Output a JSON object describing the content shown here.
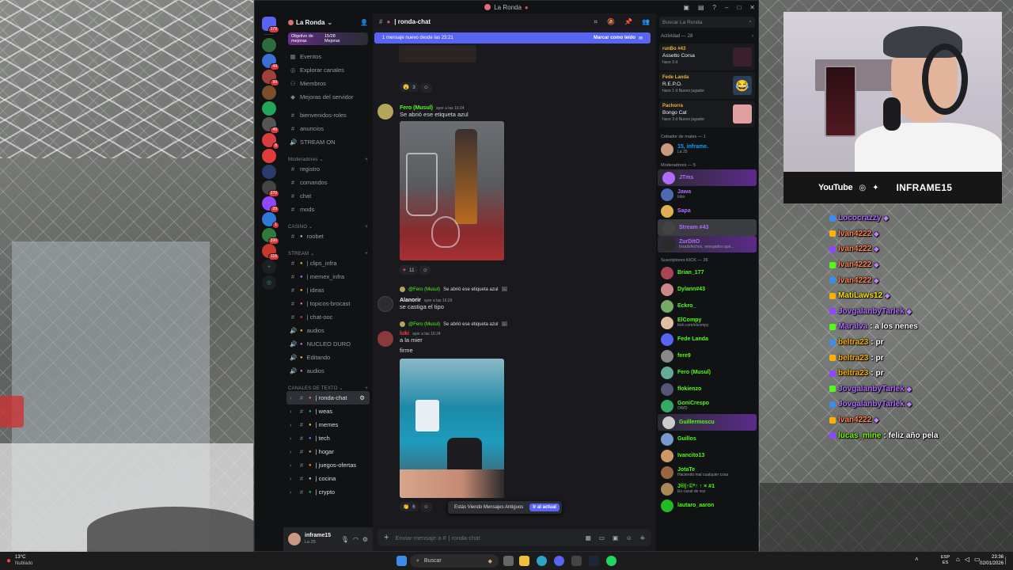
{
  "window": {
    "title": "La Ronda"
  },
  "rail": {
    "servers": [
      {
        "name": "home",
        "badge": "179",
        "color": "#5865f2"
      },
      {
        "name": "la-ronda",
        "badge": "",
        "color": "#2d6b3a"
      },
      {
        "name": "server-3",
        "badge": "44",
        "color": "#3b6fd6"
      },
      {
        "name": "server-4",
        "badge": "99",
        "color": "#a0403a"
      },
      {
        "name": "server-5",
        "badge": "",
        "color": "#7a4e2a"
      },
      {
        "name": "server-6",
        "badge": "",
        "color": "#23a55a"
      },
      {
        "name": "server-7",
        "badge": "49",
        "color": "#555"
      },
      {
        "name": "server-8",
        "badge": "8",
        "color": "#d83c3e"
      },
      {
        "name": "server-9",
        "badge": "",
        "color": "#e23b3b"
      },
      {
        "name": "server-10",
        "badge": "",
        "color": "#2a3b6b"
      },
      {
        "name": "server-11",
        "badge": "270",
        "color": "#444"
      },
      {
        "name": "server-12",
        "badge": "29",
        "color": "#9146ff"
      },
      {
        "name": "server-13",
        "badge": "1",
        "color": "#2f78d8"
      },
      {
        "name": "server-14",
        "badge": "330",
        "color": "#2d7a3a"
      },
      {
        "name": "server-15",
        "badge": "116",
        "color": "#c0392b"
      }
    ]
  },
  "sidebar": {
    "server_name": "La Ronda",
    "goal": {
      "label": "Objetivo de mejoras",
      "count": "15/28",
      "sub": "Mejoras"
    },
    "top_items": [
      "Eventos",
      "Explorar canales",
      "Miembros",
      "Mejoras del servidor"
    ],
    "channels_a": [
      "bienvenidos-roles",
      "anuncios",
      "STREAM ON"
    ],
    "cat_mod": "Moderadores",
    "channels_mod": [
      "registro",
      "comandos",
      "chat",
      "mods"
    ],
    "cat_casino": "CASINO",
    "channels_casino": [
      "roobet"
    ],
    "cat_stream": "STREAM",
    "channels_stream": [
      "| clips_infra",
      "| memex_infra",
      "| ideas",
      "| topicos-brocast",
      "| chat-ooc",
      "audios",
      "NUCLEO DURO",
      "Editando",
      "audios"
    ],
    "cat_text": "CANALES DE TEXTO",
    "channels_text": [
      "| ronda-chat",
      "| weas",
      "| memes",
      "| tech",
      "| hogar",
      "| juegos-ofertas",
      "| cocina",
      "| crypto"
    ],
    "user": {
      "name": "inframe15",
      "status": "La 25"
    }
  },
  "chat": {
    "channel": "| ronda-chat",
    "new_messages": "1 mensaje nuevo desde las 23:21",
    "mark_read": "Marcar como leído",
    "reaction_top": "3",
    "msg1": {
      "author": "Fero (Musul)",
      "time": "ayer a las 16:24",
      "text": "Se abrió ese etiqueta azul",
      "reaction": "11"
    },
    "msg2": {
      "reply_author": "@Fero (Musul)",
      "reply_text": "Se abrió ese etiqueta azul",
      "author": "Alanorir",
      "time": "ayer a las 16:29",
      "text": "se castiga el tipo"
    },
    "msg3": {
      "reply_author": "@Fero (Musul)",
      "reply_text": "Se abrió ese etiqueta azul",
      "author": "luki",
      "time": "ayer a las 16:24",
      "text1": "a la mier",
      "text2": "firme",
      "reaction": "6"
    },
    "old_notice": "Estás Viendo Mensajes Antiguos",
    "jump": "Ir al actual",
    "input_placeholder": "Enviar mensaje a #",
    "input_channel": "| ronda-chat"
  },
  "members": {
    "search_placeholder": "Buscar La Ronda",
    "activity_header": "Actividad — 28",
    "activities": [
      {
        "user": "runBo #43",
        "game": "Assetto Corsa",
        "meta": "hace 3 d",
        "color": "#f0b232"
      },
      {
        "user": "Fede Landa",
        "game": "R.E.P.O.",
        "meta": "hace 1 d  Nuevo jugador",
        "color": "#f0b232"
      },
      {
        "user": "Pachorra",
        "game": "Bongo Cat",
        "meta": "hace 3 d  Nuevo jugador",
        "color": "#f0b232"
      }
    ],
    "groups": [
      {
        "title": "Cebador de mates — 1",
        "items": [
          {
            "name": "15, inframe.",
            "sub": "La 25",
            "color": "#00a8fc"
          }
        ]
      },
      {
        "title": "Moderadores — 5",
        "items": [
          {
            "name": "JTms",
            "sub": "",
            "color": "#b06cff"
          },
          {
            "name": "Jawa",
            "sub": "lobo",
            "color": "#b06cff"
          },
          {
            "name": "Sapa",
            "sub": "",
            "color": "#b06cff"
          },
          {
            "name": "Stream #43",
            "sub": "",
            "color": "#b06cff"
          },
          {
            "name": "ZurDitO",
            "sub": "Insatisfechos, renegados que...",
            "color": "#b06cff"
          }
        ]
      },
      {
        "title": "Suscriptores KICK — 26",
        "items": [
          {
            "name": "Brian_177",
            "sub": "",
            "color": "#53fc18"
          },
          {
            "name": "Dylann#43",
            "sub": "",
            "color": "#53fc18"
          },
          {
            "name": "Eckro_",
            "sub": "",
            "color": "#53fc18"
          },
          {
            "name": "ElCompy",
            "sub": "kick.com/elcompy",
            "color": "#53fc18"
          },
          {
            "name": "Fede Landa",
            "sub": "",
            "color": "#53fc18"
          },
          {
            "name": "fere9",
            "sub": "",
            "color": "#53fc18"
          },
          {
            "name": "Fero (Musul)",
            "sub": "",
            "color": "#53fc18"
          },
          {
            "name": "flokienzo",
            "sub": "",
            "color": "#53fc18"
          },
          {
            "name": "GoniCrespo",
            "sub": "OWO",
            "color": "#53fc18"
          },
          {
            "name": "Guillermoscu",
            "sub": "",
            "color": "#53fc18"
          },
          {
            "name": "Guillos",
            "sub": "",
            "color": "#53fc18"
          },
          {
            "name": "Ivancito13",
            "sub": "",
            "color": "#53fc18"
          },
          {
            "name": "JotaTe",
            "sub": "Haciendo mal cualquier cosa",
            "color": "#53fc18"
          },
          {
            "name": "J®|↑©ª↑ ↑ × #1",
            "sub": "En canal de voz",
            "color": "#53fc18"
          },
          {
            "name": "lautaro_aaron",
            "sub": "",
            "color": "#53fc18"
          }
        ]
      }
    ]
  },
  "stream": {
    "platforms": "YouTube",
    "handle": "INFRAME15",
    "chat": [
      {
        "user": "Lococrazzy",
        "msg": "",
        "color": "#b06cff"
      },
      {
        "user": "Ivan4222",
        "msg": "",
        "color": "#ff7f50"
      },
      {
        "user": "Ivan4222",
        "msg": "",
        "color": "#ff7f50"
      },
      {
        "user": "Ivan4222",
        "msg": "",
        "color": "#ff7f50"
      },
      {
        "user": "Ivan4222",
        "msg": "",
        "color": "#ff7f50"
      },
      {
        "user": "MatiLaws12",
        "msg": "",
        "color": "#ffe600"
      },
      {
        "user": "JovgalanbyTarlek",
        "msg": "",
        "color": "#b06cff"
      },
      {
        "user": "Maralva",
        "msg": ": a los nenes",
        "color": "#b06cff"
      },
      {
        "user": "beltra23",
        "msg": ": pr",
        "color": "#ffb000"
      },
      {
        "user": "beltra23",
        "msg": ": pr",
        "color": "#ffb000"
      },
      {
        "user": "beltra23",
        "msg": ": pr",
        "color": "#ffb000"
      },
      {
        "user": "JovgalanbyTarlek",
        "msg": "",
        "color": "#b06cff"
      },
      {
        "user": "JovgalanbyTarlek",
        "msg": "",
        "color": "#b06cff"
      },
      {
        "user": "Ivan4222",
        "msg": "",
        "color": "#ff7f50"
      },
      {
        "user": "lucas_mine",
        "msg": ": feliz año pela",
        "color": "#7cfc00"
      }
    ]
  },
  "taskbar": {
    "weather_temp": "13°C",
    "weather_text": "Nublado",
    "search": "Buscar",
    "lang": "ESP",
    "lang2": "ES",
    "time": "23:36",
    "date": "02/01/2026"
  }
}
